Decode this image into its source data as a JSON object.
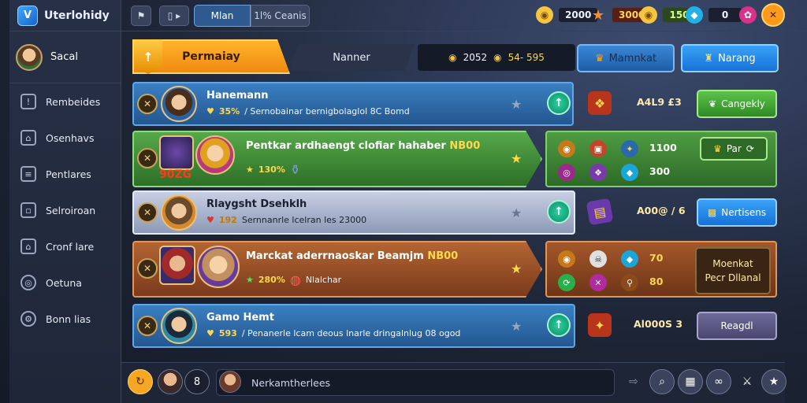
{
  "app": {
    "title": "Uterlohidy",
    "logo_glyph": "V"
  },
  "profile": {
    "name": "Sacal"
  },
  "sidebar": {
    "items": [
      {
        "label": "Rembeides",
        "icon": "shield-icon"
      },
      {
        "label": "Osenhavs",
        "icon": "home-icon"
      },
      {
        "label": "Pentlares",
        "icon": "list-icon"
      },
      {
        "label": "Selroiroan",
        "icon": "bag-icon"
      },
      {
        "label": "Cronf lare",
        "icon": "home-icon"
      },
      {
        "label": "Oetuna",
        "icon": "globe-icon"
      },
      {
        "label": "Bonn lias",
        "icon": "gear-icon"
      }
    ]
  },
  "topbar": {
    "tab_main": "Mlan",
    "tab_count": "1l% Ceanis",
    "resources": [
      {
        "icon": "gold-coin-icon",
        "value": "2000",
        "color": "#f5c542"
      },
      {
        "icon": "star-icon",
        "value": "3000",
        "color": "#ff8a2a"
      },
      {
        "icon": "gold-coin-icon",
        "value": "150",
        "color": "#f5c542"
      },
      {
        "icon": "gem-icon",
        "value": "0",
        "color": "#3fd6ff"
      }
    ]
  },
  "header": {
    "tab_primary": "Permaiay",
    "tab_secondary": "Nanner",
    "res_a": "2052",
    "res_b": "54- 595",
    "btn_mid": "Mamnkat",
    "btn_right": "Narang"
  },
  "rows": [
    {
      "name": "Hanemann",
      "level": "35%",
      "desc": "/ Sernobainar bernigbolaglol 8C Bomd",
      "right_val": "A4L9 £3",
      "action": "Cangekly"
    },
    {
      "name": "Pentkar ardhaengt clofiar hahaber",
      "name_badge": "NB00",
      "avatar_badge": "90ZG",
      "level": "130%",
      "right_vals": [
        "1100",
        "300"
      ],
      "action": "Par"
    },
    {
      "name": "Rlaygsht Dsehklh",
      "level": "192",
      "desc": "Sernnanrle lcelran  les 23000",
      "right_val": "A00@ / 6",
      "action": "Nertisens"
    },
    {
      "name": "Marckat aderrnaoskar Beamjm",
      "name_badge": "NB00",
      "level": "280%",
      "desc": "Nlalchar",
      "right_vals": [
        "70",
        "80"
      ],
      "action_line1": "Moenkat",
      "action_line2": "Pecr Dllanal"
    },
    {
      "name": "Gamo Hemt",
      "level": "593",
      "desc": "/ Penanerle lcam deous lnarle dringalnlug 08 ogod",
      "right_val": "Al000S 3",
      "action": "Reagdl"
    }
  ],
  "bottom": {
    "badge_count": "8",
    "chat_placeholder": "Nerkamtherlees"
  },
  "colors": {
    "accent": "#f5a623",
    "blue_row": "#2c6aa6",
    "green_row": "#3f8a3a",
    "silver_row": "#9aa6c4",
    "orange_row": "#a4572a"
  }
}
